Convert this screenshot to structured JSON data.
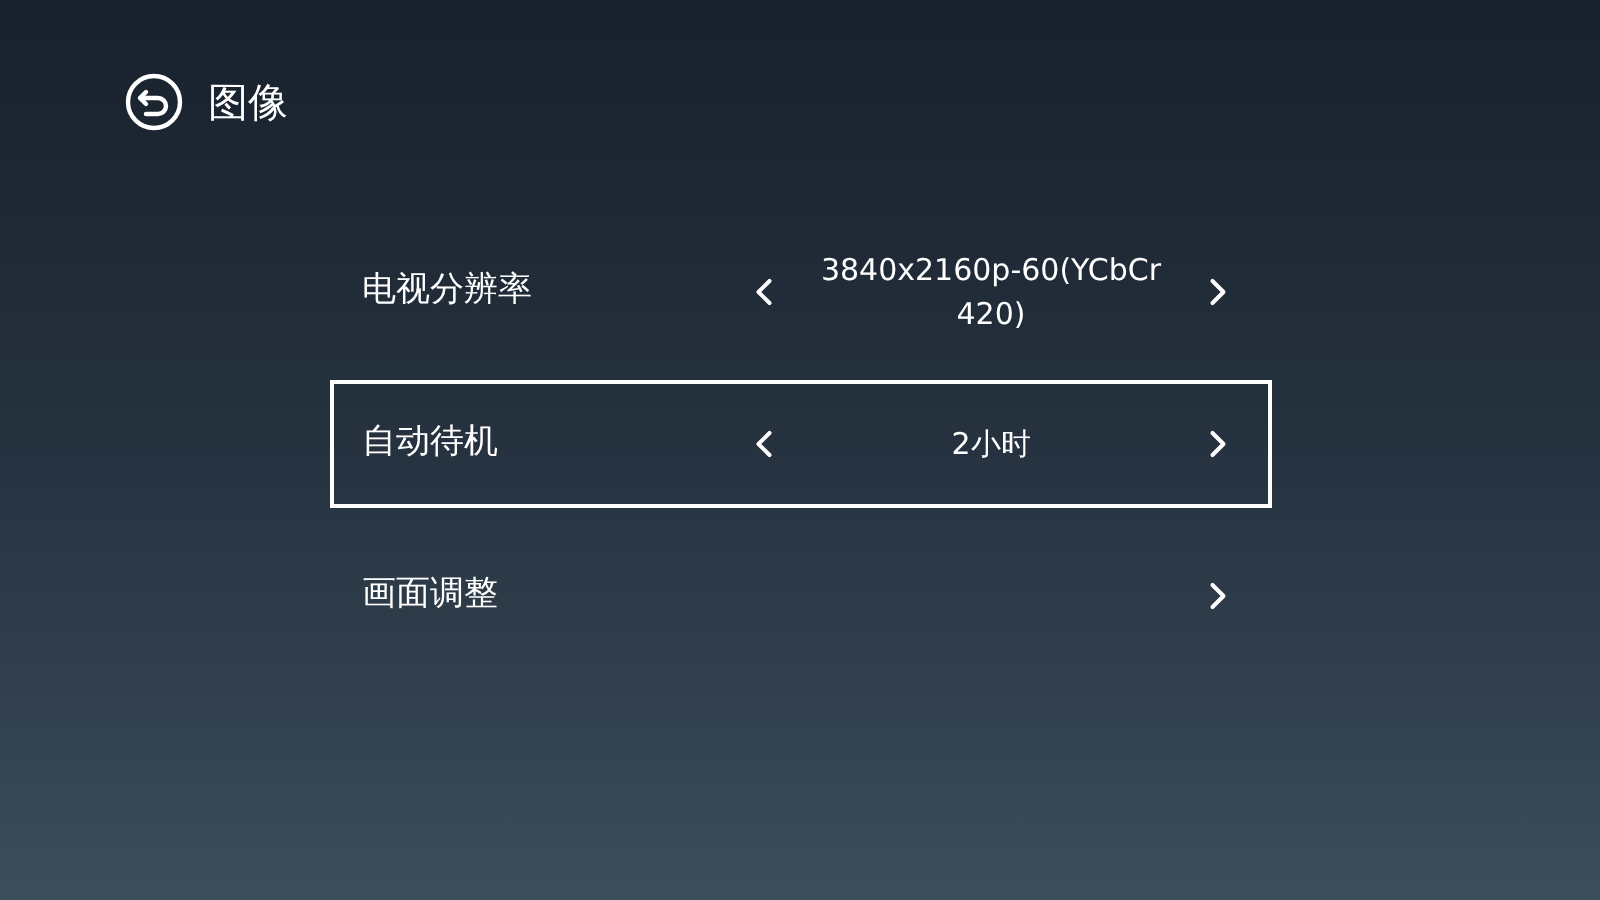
{
  "header": {
    "title": "图像"
  },
  "rows": [
    {
      "kind": "choice",
      "label": "电视分辨率",
      "value": "3840x2160p-60(YCbCr 420)",
      "selected": false
    },
    {
      "kind": "choice",
      "label": "自动待机",
      "value": "2小时",
      "selected": true
    },
    {
      "kind": "link",
      "label": "画面调整",
      "selected": false
    }
  ]
}
